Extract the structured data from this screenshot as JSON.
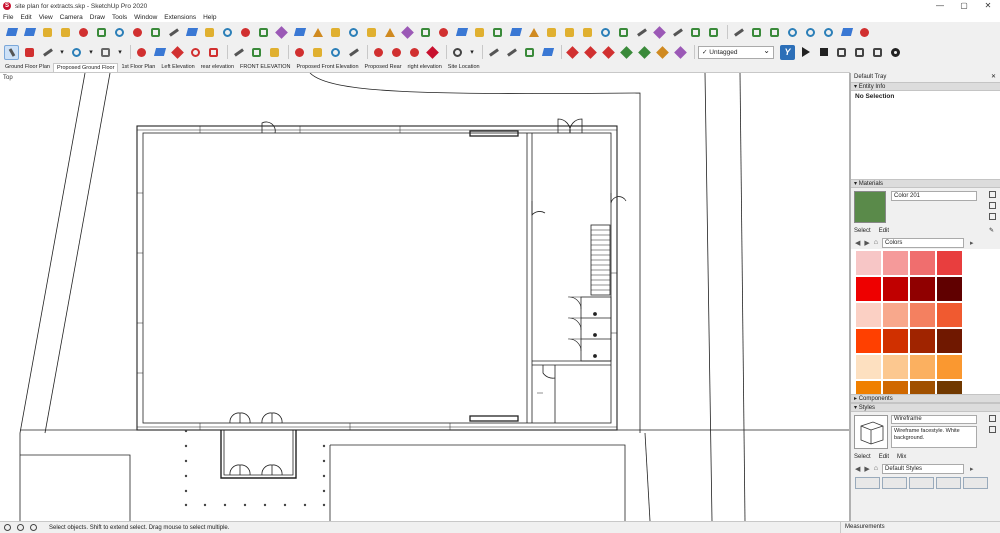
{
  "window": {
    "title": "site plan for extracts.skp - SketchUp Pro 2020",
    "minimize": "—",
    "maximize": "▢",
    "close": "✕"
  },
  "menu": [
    "File",
    "Edit",
    "View",
    "Camera",
    "Draw",
    "Tools",
    "Window",
    "Extensions",
    "Help"
  ],
  "toolbar": {
    "tag_value": "Untagged"
  },
  "scenes": [
    "Ground Floor Plan",
    "Proposed Ground Floor",
    "1st Floor Plan",
    "Left Elevation",
    "rear elevation",
    "FRONT ELEVATION",
    "Proposed Front Elevation",
    "Proposed Rear",
    "right elevation",
    "Site Location"
  ],
  "active_scene": "Proposed Ground Floor",
  "viewport": {
    "view_name": "Top"
  },
  "tray": {
    "title": "Default Tray",
    "close": "✕",
    "entity_info": {
      "header": "Entity Info",
      "selection": "No Selection"
    },
    "materials": {
      "header": "Materials",
      "name": "Color 201",
      "swatch_color": "#5a8a4a",
      "tab_select": "Select",
      "tab_edit": "Edit",
      "library": "Colors",
      "swatches": [
        "#f7c6c6",
        "#f59a9a",
        "#f06e6e",
        "#e83e3e",
        "#ee0000",
        "#c00000",
        "#900000",
        "#600000",
        "#fbd0c4",
        "#f8a88c",
        "#f48060",
        "#f05a30",
        "#ff4000",
        "#d03000",
        "#a02400",
        "#701800",
        "#fde0c0",
        "#fcc890",
        "#fbb060",
        "#fa9830",
        "#f08000",
        "#d06800",
        "#a05000",
        "#703800"
      ]
    },
    "components": {
      "header": "Components"
    },
    "styles": {
      "header": "Styles",
      "name": "Wireframe",
      "description": "Wireframe facestyle.  White background.",
      "tab_select": "Select",
      "tab_edit": "Edit",
      "tab_mix": "Mix",
      "library": "Default Styles"
    }
  },
  "status": {
    "message": "Select objects. Shift to extend select. Drag mouse to select multiple.",
    "measurements_label": "Measurements"
  }
}
